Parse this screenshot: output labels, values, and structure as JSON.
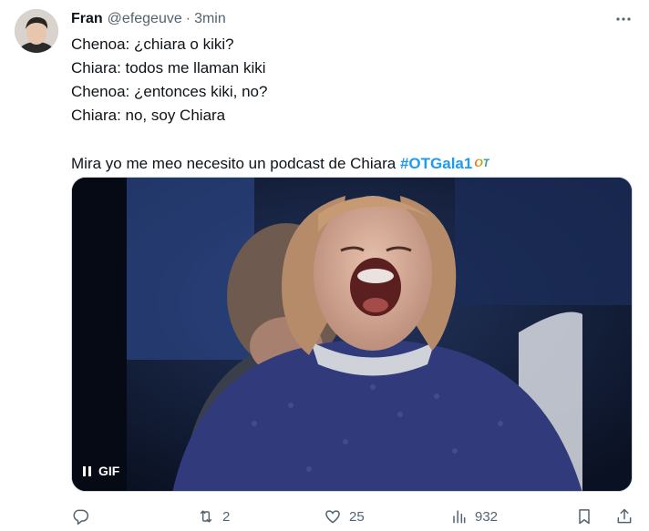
{
  "tweet": {
    "author_name": "Fran",
    "author_handle": "@efegeuve",
    "separator": "·",
    "time": "3min",
    "more_label": "···",
    "lines": [
      "Chenoa: ¿chiara o kiki?",
      "Chiara: todos me llaman kiki",
      "Chenoa: ¿entonces kiki, no?",
      "Chiara: no, soy Chiara"
    ],
    "final_text": "Mira yo me meo necesito un podcast de Chiara ",
    "hashtag": "#OTGala1",
    "hashtag_emoji": "OT"
  },
  "media": {
    "type": "gif",
    "badge": "GIF",
    "state": "playing"
  },
  "actions": {
    "reply": {
      "icon": "reply-icon",
      "count": ""
    },
    "retweet": {
      "icon": "retweet-icon",
      "count": "2"
    },
    "like": {
      "icon": "heart-icon",
      "count": "25"
    },
    "views": {
      "icon": "views-icon",
      "count": "932"
    },
    "bookmark": {
      "icon": "bookmark-icon"
    },
    "share": {
      "icon": "share-icon"
    }
  },
  "colors": {
    "accent": "#1d9bf0",
    "text": "#0f1419",
    "muted": "#536471"
  }
}
